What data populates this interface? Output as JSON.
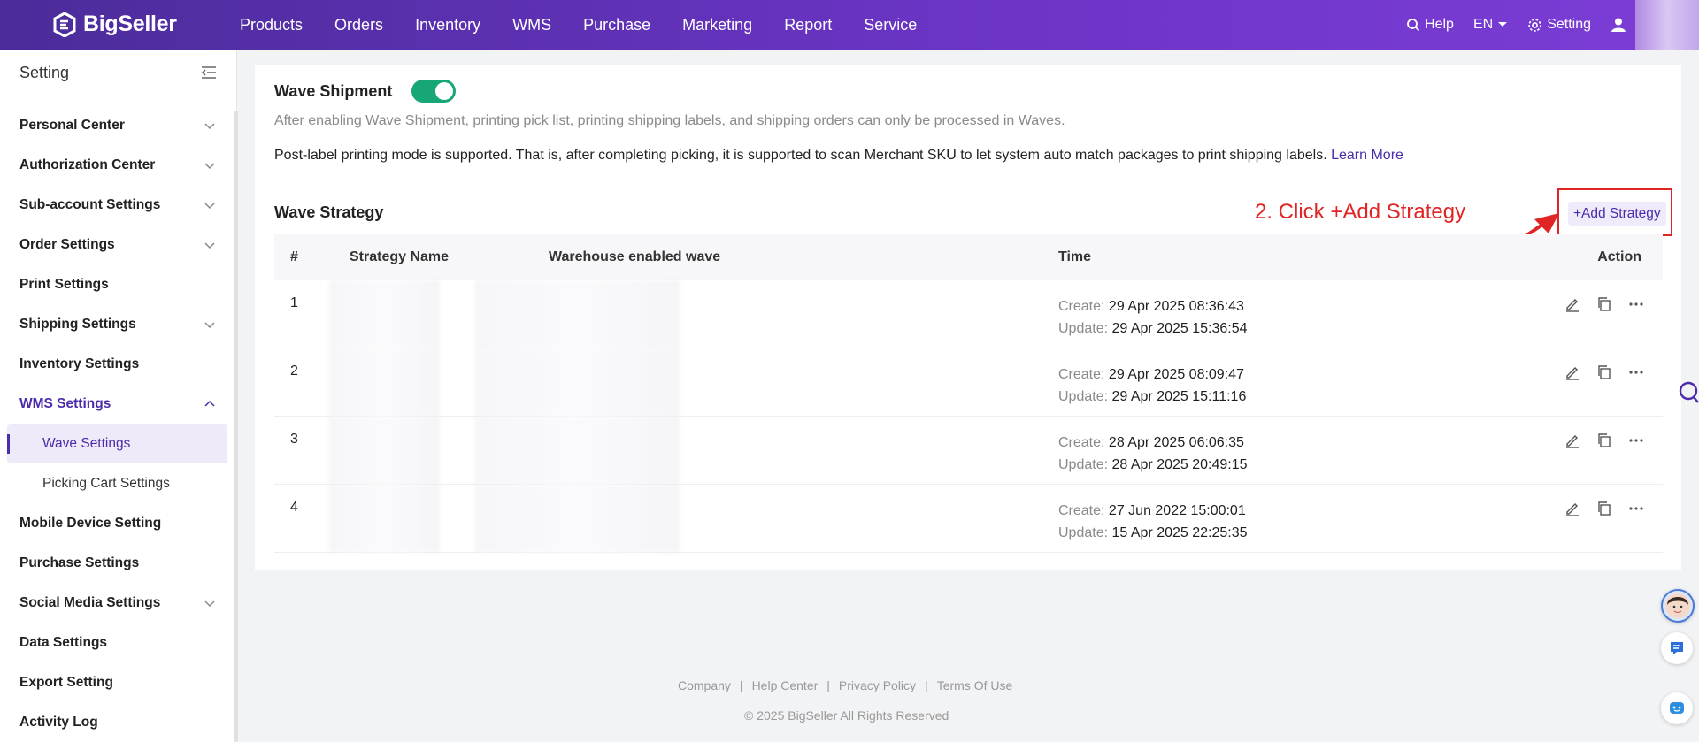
{
  "app": {
    "logo_text": "BigSeller"
  },
  "nav": {
    "items": [
      "Products",
      "Orders",
      "Inventory",
      "WMS",
      "Purchase",
      "Marketing",
      "Report",
      "Service"
    ],
    "help": "Help",
    "lang": "EN",
    "setting": "Setting"
  },
  "sidebar": {
    "title": "Setting",
    "items": [
      {
        "label": "Personal Center",
        "chevron": "down"
      },
      {
        "label": "Authorization Center",
        "chevron": "down"
      },
      {
        "label": "Sub-account Settings",
        "chevron": "down"
      },
      {
        "label": "Order Settings",
        "chevron": "down"
      },
      {
        "label": "Print Settings",
        "chevron": ""
      },
      {
        "label": "Shipping Settings",
        "chevron": "down"
      },
      {
        "label": "Inventory Settings",
        "chevron": ""
      },
      {
        "label": "WMS Settings",
        "chevron": "up"
      }
    ],
    "sub_items": [
      "Wave Settings",
      "Picking Cart Settings"
    ],
    "items_after": [
      {
        "label": "Mobile Device Setting",
        "chevron": ""
      },
      {
        "label": "Purchase Settings",
        "chevron": ""
      },
      {
        "label": "Social Media Settings",
        "chevron": "down"
      },
      {
        "label": "Data Settings",
        "chevron": ""
      },
      {
        "label": "Export Setting",
        "chevron": ""
      },
      {
        "label": "Activity Log",
        "chevron": ""
      }
    ]
  },
  "main": {
    "wave_label": "Wave Shipment",
    "wave_enabled": true,
    "desc1": "After enabling Wave Shipment, printing pick list, printing shipping labels, and shipping orders can only be processed in Waves.",
    "desc2": "Post-label printing mode is supported. That is, after completing picking, it is supported to scan Merchant SKU to let system auto match packages to print shipping labels.",
    "learn_more": "Learn More",
    "strategy_title": "Wave Strategy",
    "add_button": "+Add Strategy",
    "annotation": "2. Click +Add Strategy",
    "accent_color": "#4b2cab",
    "annotation_color": "#e12424"
  },
  "table": {
    "headers": [
      "#",
      "Strategy Name",
      "Warehouse enabled wave",
      "Time",
      "Action"
    ],
    "create_label": "Create:",
    "update_label": "Update:",
    "rows": [
      {
        "idx": "1",
        "create": "29 Apr 2025 08:36:43",
        "update": "29 Apr 2025 15:36:54"
      },
      {
        "idx": "2",
        "create": "29 Apr 2025 08:09:47",
        "update": "29 Apr 2025 15:11:16"
      },
      {
        "idx": "3",
        "create": "28 Apr 2025 06:06:35",
        "update": "28 Apr 2025 20:49:15"
      },
      {
        "idx": "4",
        "create": "27 Jun 2022 15:00:01",
        "update": "15 Apr 2025 22:25:35"
      }
    ]
  },
  "footer": {
    "links": [
      "Company",
      "Help Center",
      "Privacy Policy",
      "Terms Of Use"
    ],
    "copyright": "© 2025 BigSeller All Rights Reserved"
  }
}
